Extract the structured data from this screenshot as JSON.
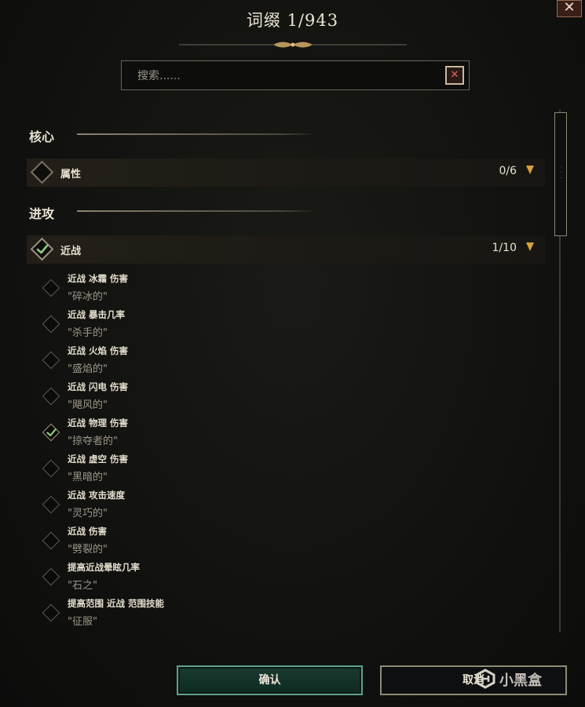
{
  "window": {
    "title": "词缀 1/943",
    "close_label": "✕"
  },
  "search": {
    "placeholder": "搜索......",
    "value": "",
    "clear_label": "✕"
  },
  "sections": [
    {
      "label": "核心",
      "categories": [
        {
          "label": "属性",
          "count": "0/6",
          "checked": false
        }
      ]
    },
    {
      "label": "进攻",
      "categories": [
        {
          "label": "近战",
          "count": "1/10",
          "checked": true
        }
      ]
    }
  ],
  "items": [
    {
      "name": "近战 冰霜 伤害",
      "sub": "\"碎冰的\"",
      "checked": false
    },
    {
      "name": "近战 暴击几率",
      "sub": "\"杀手的\"",
      "checked": false
    },
    {
      "name": "近战 火焰 伤害",
      "sub": "\"盛焰的\"",
      "checked": false
    },
    {
      "name": "近战 闪电 伤害",
      "sub": "\"飓风的\"",
      "checked": false
    },
    {
      "name": "近战 物理 伤害",
      "sub": "\"掠夺者的\"",
      "checked": true
    },
    {
      "name": "近战 虚空 伤害",
      "sub": "\"黑暗的\"",
      "checked": false
    },
    {
      "name": "近战 攻击速度",
      "sub": "\"灵巧的\"",
      "checked": false
    },
    {
      "name": "近战 伤害",
      "sub": "\"劈裂的\"",
      "checked": false
    },
    {
      "name": "提高近战晕眩几率",
      "sub": "\"石之\"",
      "checked": false
    },
    {
      "name": "提高范围 近战 范围技能",
      "sub": "\"征服\"",
      "checked": false
    }
  ],
  "footer": {
    "confirm_label": "确认",
    "cancel_label": "取消",
    "watermark": "小黑盒"
  },
  "colors": {
    "accent_gold": "#d8a03a",
    "check_green": "#8fc77a",
    "confirm_green": "#1a3a30",
    "close_red": "#3a1e18"
  },
  "icons": {
    "close": "close-icon",
    "clear": "clear-icon",
    "arrow": "chevron-down-icon",
    "check": "checkmark-icon"
  }
}
